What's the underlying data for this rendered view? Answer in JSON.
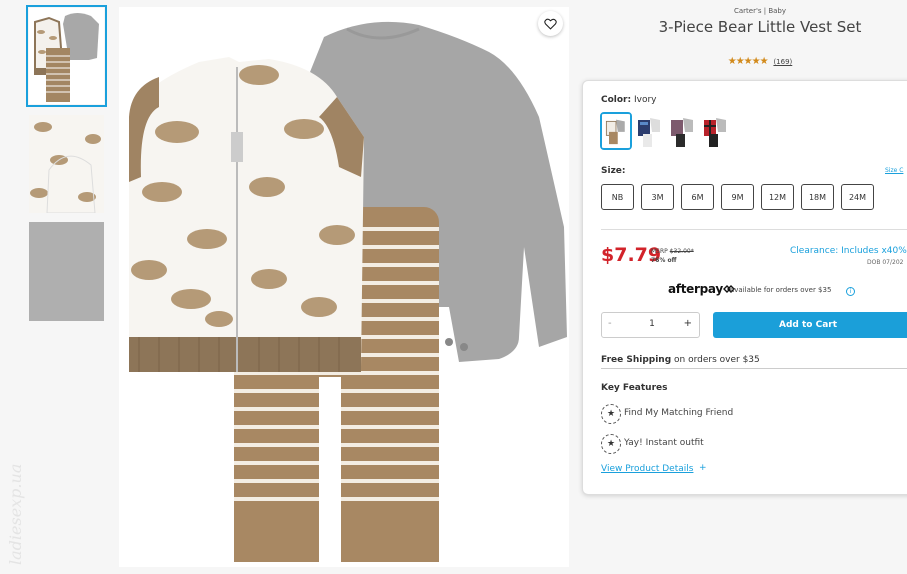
{
  "product": {
    "brand": "Carter's | Baby",
    "title": "3-Piece Bear Little Vest Set",
    "stars": "★★★★★",
    "rating_fraction": 1.0,
    "review_count": "(169)"
  },
  "watermark": "ladiesexp.ua",
  "thumbnails": [
    {
      "name": "full-set",
      "selected": true
    },
    {
      "name": "vest-closeup",
      "selected": false
    },
    {
      "name": "bodysuit-closeup",
      "selected": false
    }
  ],
  "color": {
    "label": "Color:",
    "selected": "Ivory",
    "swatch_count": 4
  },
  "size": {
    "label": "Size:",
    "chart_link": "Size C",
    "options": [
      "NB",
      "3M",
      "6M",
      "9M",
      "12M",
      "18M",
      "24M"
    ]
  },
  "price": {
    "current": "$7.79",
    "msrp_label": "MSRP",
    "msrp_value": "$32.00*",
    "percent_off": "76% off",
    "clearance": "Clearance: Includes x40%",
    "dob": "DOB 07/202"
  },
  "afterpay": {
    "logo": "afterpay",
    "text": "available for orders over $35",
    "info": "i"
  },
  "quantity": {
    "minus": "-",
    "value": "1",
    "plus": "+"
  },
  "cart": {
    "add_label": "Add to Cart"
  },
  "shipping": {
    "bold": "Free Shipping",
    "rest": " on orders over $35"
  },
  "features": {
    "title": "Key Features",
    "items": [
      "Find My Matching Friend",
      "Yay! Instant outfit"
    ],
    "view_details": "View Product Details",
    "view_plus": "+"
  },
  "colors": {
    "accent": "#1aa0dc",
    "price_red": "#d2232a",
    "cart_blue": "#1b9fd9",
    "star_gold": "#d28a1b"
  }
}
